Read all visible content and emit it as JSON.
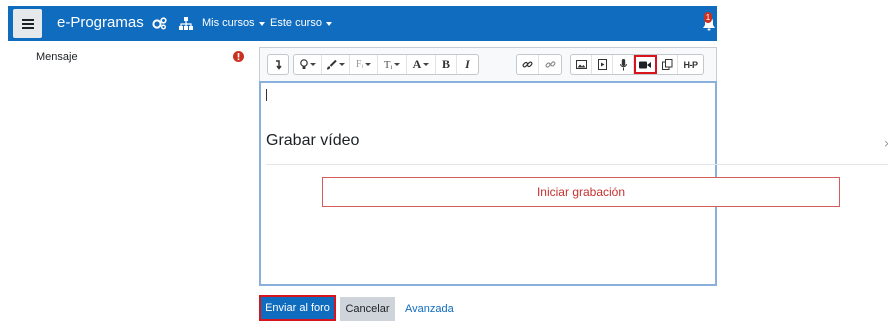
{
  "navbar": {
    "brand": "e-Programas",
    "menus": [
      {
        "label": "Mis cursos"
      },
      {
        "label": "Este curso"
      }
    ],
    "notification_count": "1",
    "color": "#0f6cbf"
  },
  "form": {
    "message_label": "Mensaje"
  },
  "toolbar": {
    "buttons": [
      "collapse-icon",
      "lightbulb-icon",
      "brush-icon",
      "font-family-icon",
      "text-size-icon",
      "font-color-icon",
      "bold-icon",
      "italic-icon",
      "link-icon",
      "unlink-icon",
      "image-icon",
      "media-icon",
      "microphone-icon",
      "video-camera-icon",
      "copy-icon",
      "h5p-icon"
    ],
    "font_family_glyph": "Fᵢ",
    "text_size_glyph": "Tᵢ",
    "font_color_glyph": "A",
    "bold_glyph": "B",
    "italic_glyph": "I",
    "h5p_glyph": "H-P"
  },
  "modal": {
    "title": "Grabar vídeo",
    "start_button": "Iniciar grabación",
    "close_glyph": "×"
  },
  "actions": {
    "submit": "Enviar al foro",
    "cancel": "Cancelar",
    "advanced": "Avanzada"
  },
  "colors": {
    "primary": "#0f6cbf",
    "highlight": "#d8151c",
    "danger": "#c4312f"
  }
}
